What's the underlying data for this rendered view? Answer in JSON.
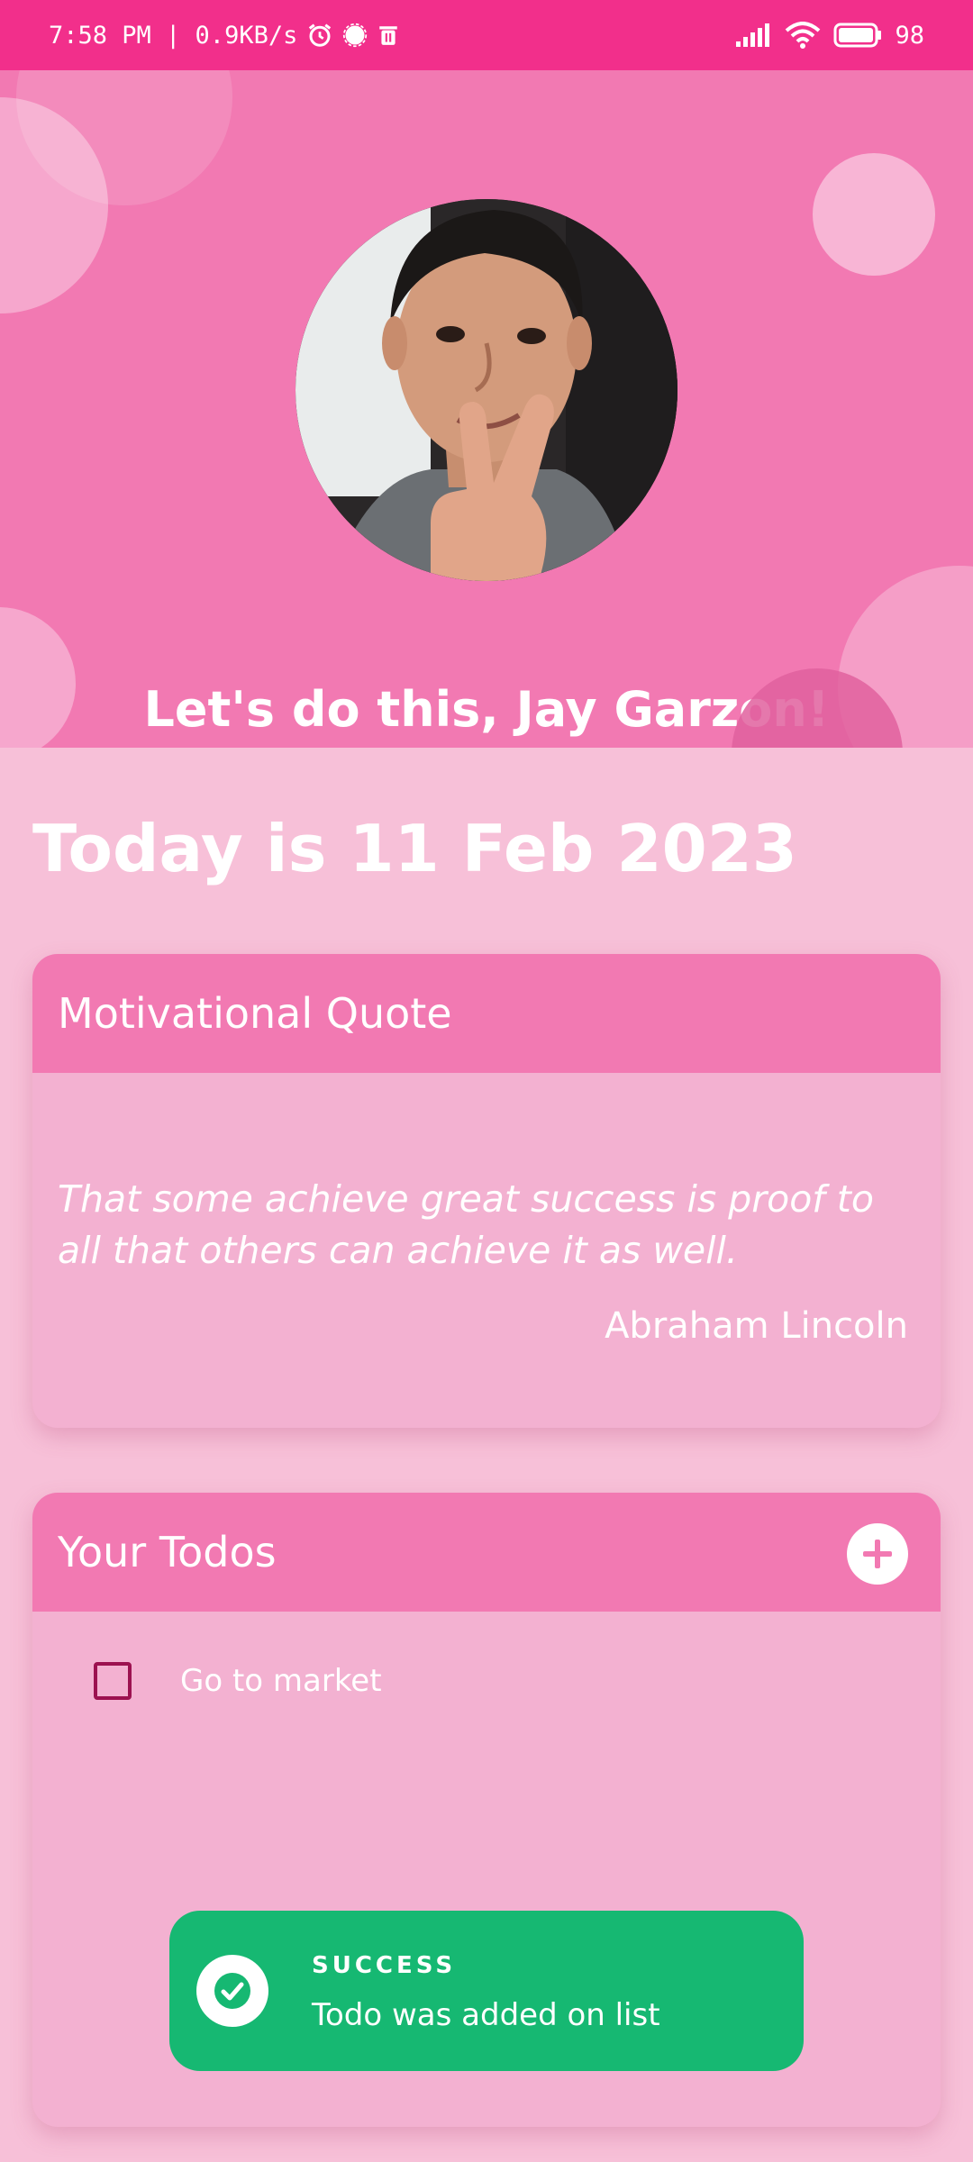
{
  "status_bar": {
    "left_text": "7:58 PM | 0.9KB/s",
    "battery": "98",
    "icons": [
      "alarm-icon",
      "signal-app-icon",
      "trash-icon",
      "cell-signal-icon",
      "wifi-icon",
      "battery-icon"
    ]
  },
  "header": {
    "greeting": "Let's do this, Jay Garzon!"
  },
  "today": "Today is 11 Feb 2023",
  "quote_card": {
    "title": "Motivational Quote",
    "quote": "That some achieve great success is proof to all that others can achieve it as well.",
    "author": "Abraham Lincoln"
  },
  "todo_card": {
    "title": "Your Todos",
    "items": [
      {
        "label": "Go to market",
        "checked": false
      }
    ]
  },
  "toast": {
    "title": "SUCCESS",
    "message": "Todo was added on list",
    "color": "#16b872"
  },
  "colors": {
    "status_bar": "#f22f8b",
    "header": "#f279b2",
    "background": "#f7c0d8",
    "card": "#f3b1d1"
  }
}
